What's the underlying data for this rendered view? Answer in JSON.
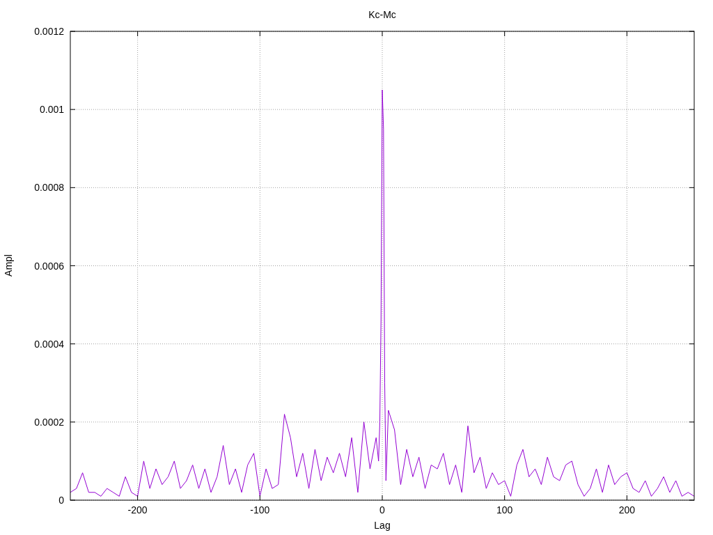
{
  "chart_data": {
    "type": "line",
    "title": "Kc-Mc",
    "xlabel": "Lag",
    "ylabel": "Ampl",
    "xlim": [
      -255,
      255
    ],
    "ylim": [
      0,
      0.0012
    ],
    "xticks": [
      -200,
      -100,
      0,
      100,
      200
    ],
    "yticks": [
      {
        "value": 0,
        "label": "0"
      },
      {
        "value": 0.0002,
        "label": "0.0002"
      },
      {
        "value": 0.0004,
        "label": "0.0004"
      },
      {
        "value": 0.0006,
        "label": "0.0006"
      },
      {
        "value": 0.0008,
        "label": "0.0008"
      },
      {
        "value": 0.001,
        "label": "0.001"
      },
      {
        "value": 0.0012,
        "label": "0.0012"
      }
    ],
    "x": [
      -255,
      -250,
      -245,
      -240,
      -235,
      -230,
      -225,
      -220,
      -215,
      -210,
      -205,
      -200,
      -195,
      -190,
      -185,
      -180,
      -175,
      -170,
      -165,
      -160,
      -155,
      -150,
      -145,
      -140,
      -135,
      -130,
      -125,
      -120,
      -115,
      -110,
      -105,
      -100,
      -95,
      -90,
      -85,
      -80,
      -75,
      -70,
      -65,
      -60,
      -55,
      -50,
      -45,
      -40,
      -35,
      -30,
      -25,
      -20,
      -15,
      -10,
      -5,
      -3,
      -2,
      -1,
      0,
      1,
      2,
      3,
      5,
      10,
      15,
      20,
      25,
      30,
      35,
      40,
      45,
      50,
      55,
      60,
      65,
      70,
      75,
      80,
      85,
      90,
      95,
      100,
      105,
      110,
      115,
      120,
      125,
      130,
      135,
      140,
      145,
      150,
      155,
      160,
      165,
      170,
      175,
      180,
      185,
      190,
      195,
      200,
      205,
      210,
      215,
      220,
      225,
      230,
      235,
      240,
      245,
      250,
      255
    ],
    "grid": true,
    "series": [
      {
        "color": "#9400d3",
        "values": [
          2e-05,
          3e-05,
          7e-05,
          2e-05,
          2e-05,
          1e-05,
          3e-05,
          2e-05,
          1e-05,
          6e-05,
          2e-05,
          1e-05,
          0.0001,
          3e-05,
          8e-05,
          4e-05,
          6e-05,
          0.0001,
          3e-05,
          5e-05,
          9e-05,
          3e-05,
          8e-05,
          2e-05,
          6e-05,
          0.00014,
          4e-05,
          8e-05,
          2e-05,
          9e-05,
          0.00012,
          1e-05,
          8e-05,
          3e-05,
          4e-05,
          0.00022,
          0.00016,
          6e-05,
          0.00012,
          3e-05,
          0.00013,
          5e-05,
          0.00011,
          7e-05,
          0.00012,
          6e-05,
          0.00016,
          2e-05,
          0.0002,
          8e-05,
          0.00016,
          0.0001,
          0.0002,
          0.00046,
          0.00105,
          0.00095,
          0.0003,
          5e-05,
          0.00023,
          0.00018,
          4e-05,
          0.00013,
          6e-05,
          0.00011,
          3e-05,
          9e-05,
          8e-05,
          0.00012,
          4e-05,
          9e-05,
          2e-05,
          0.00019,
          7e-05,
          0.00011,
          3e-05,
          7e-05,
          4e-05,
          5e-05,
          1e-05,
          9e-05,
          0.00013,
          6e-05,
          8e-05,
          4e-05,
          0.00011,
          6e-05,
          5e-05,
          9e-05,
          0.0001,
          4e-05,
          1e-05,
          3e-05,
          8e-05,
          2e-05,
          9e-05,
          4e-05,
          6e-05,
          7e-05,
          3e-05,
          2e-05,
          5e-05,
          1e-05,
          3e-05,
          6e-05,
          2e-05,
          5e-05,
          1e-05,
          2e-05,
          1e-05
        ]
      }
    ]
  }
}
